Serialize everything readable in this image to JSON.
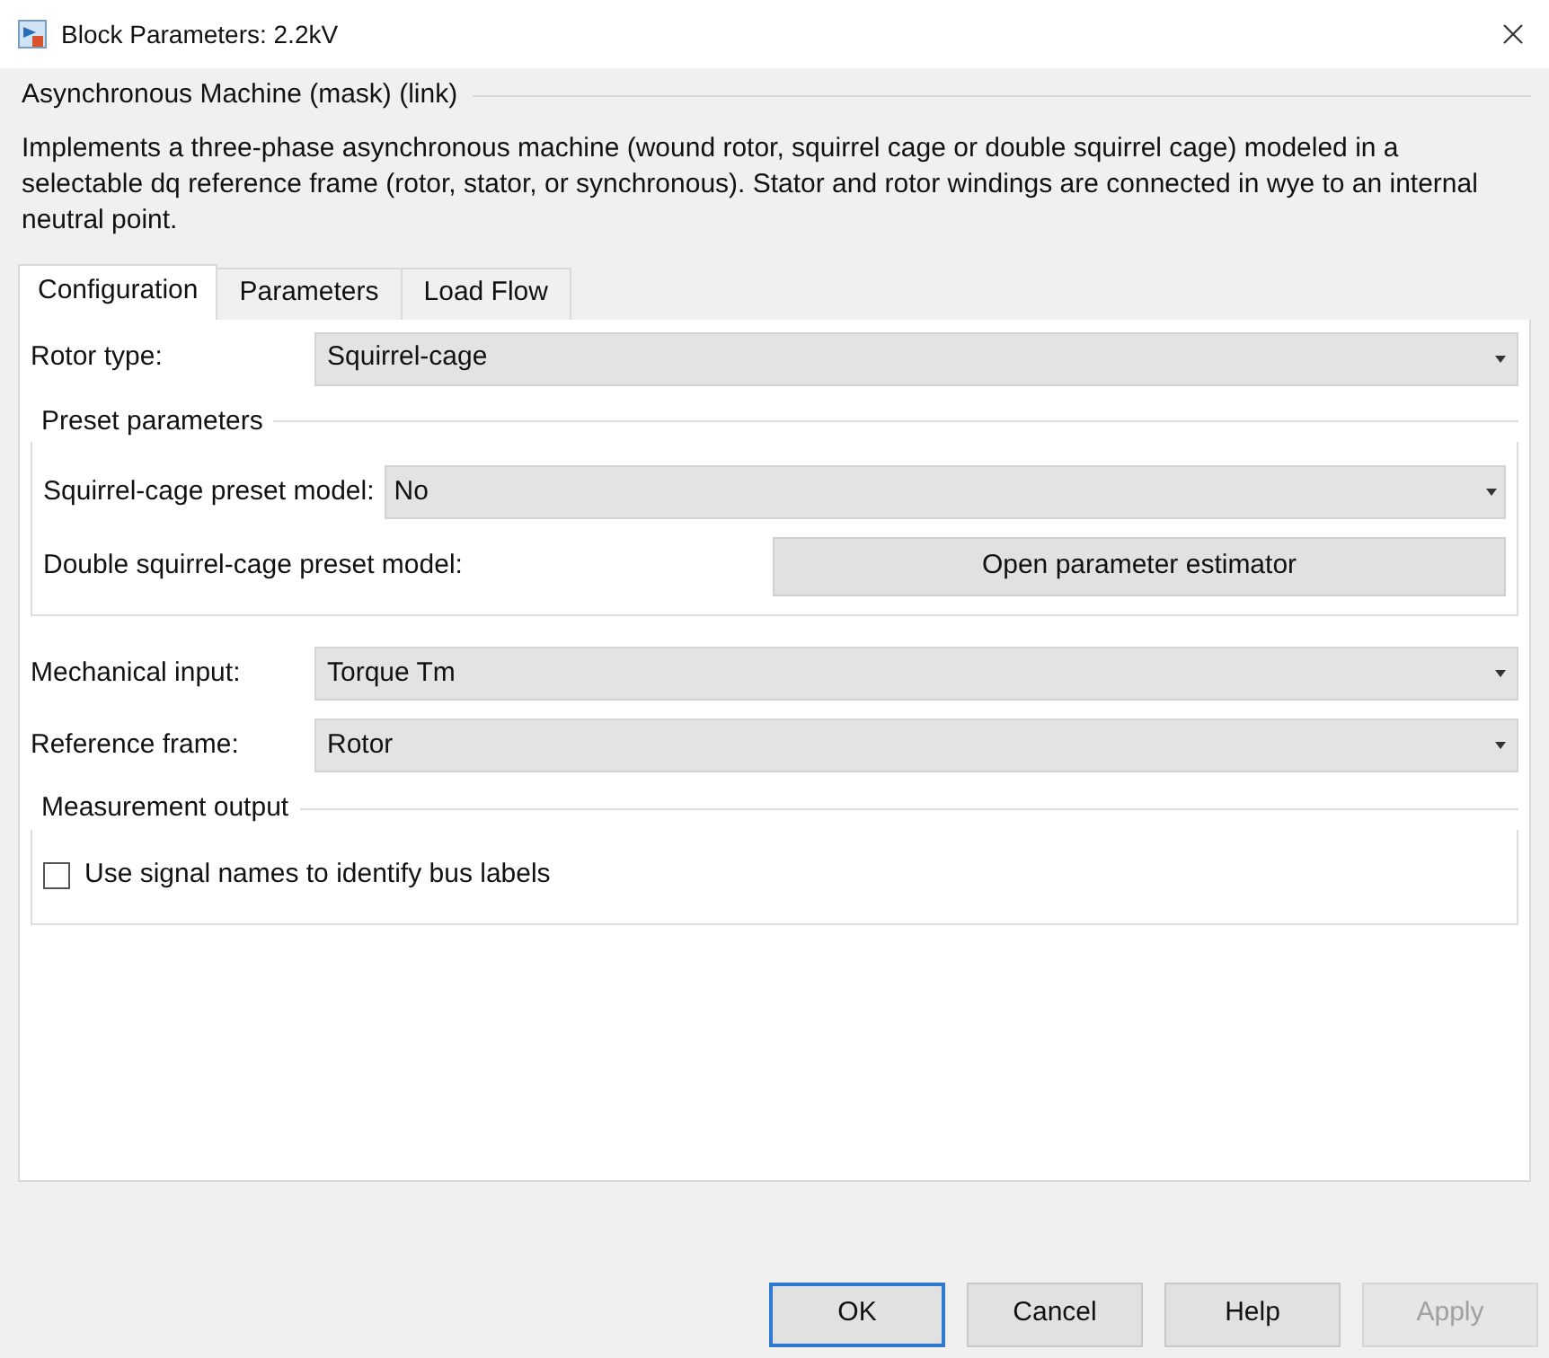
{
  "window": {
    "title": "Block Parameters: 2.2kV"
  },
  "header": {
    "group_title": "Asynchronous Machine (mask) (link)",
    "description": "Implements a three-phase asynchronous machine (wound rotor, squirrel cage or double squirrel cage) modeled in a selectable dq reference frame (rotor, stator, or synchronous). Stator and rotor windings are connected in wye to an internal neutral point."
  },
  "tabs": [
    {
      "label": "Configuration",
      "selected": true
    },
    {
      "label": "Parameters",
      "selected": false
    },
    {
      "label": "Load Flow",
      "selected": false
    }
  ],
  "rotor_type": {
    "label": "Rotor type:",
    "value": "Squirrel-cage"
  },
  "preset_parameters": {
    "title": "Preset parameters",
    "squirrel_cage_preset": {
      "label": "Squirrel-cage preset model:",
      "value": "No"
    },
    "double_squirrel_cage_preset": {
      "label": "Double squirrel-cage preset model:",
      "button": "Open parameter estimator"
    }
  },
  "mechanical_input": {
    "label": "Mechanical input:",
    "value": "Torque Tm"
  },
  "reference_frame": {
    "label": "Reference frame:",
    "value": "Rotor"
  },
  "measurement_output": {
    "title": "Measurement output",
    "checkbox": {
      "label": "Use signal names to identify bus labels",
      "checked": false
    }
  },
  "buttons": [
    {
      "label": "OK",
      "disabled": false,
      "default": true
    },
    {
      "label": "Cancel",
      "disabled": false,
      "default": false
    },
    {
      "label": "Help",
      "disabled": false,
      "default": false
    },
    {
      "label": "Apply",
      "disabled": true,
      "default": false
    }
  ]
}
